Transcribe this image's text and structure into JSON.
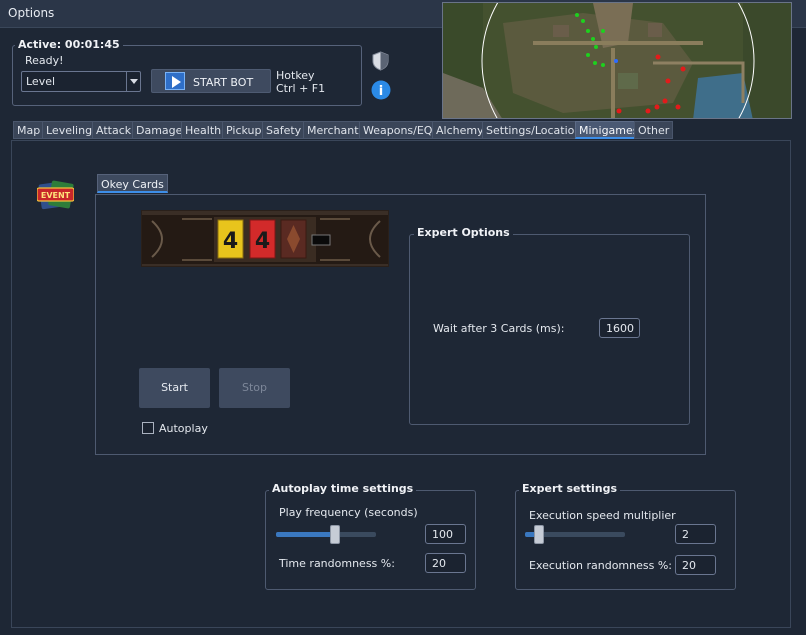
{
  "window": {
    "title": "Options"
  },
  "status": {
    "active_label": "Active: 00:01:45",
    "state": "Ready!",
    "mode": "Level",
    "start_button": "START BOT",
    "hotkey_label": "Hotkey",
    "hotkey_value": "Ctrl + F1",
    "info_icon_text": "i"
  },
  "tabs": [
    {
      "label": "Map"
    },
    {
      "label": "Leveling"
    },
    {
      "label": "Attack"
    },
    {
      "label": "Damage"
    },
    {
      "label": "Health"
    },
    {
      "label": "Pickup"
    },
    {
      "label": "Safety"
    },
    {
      "label": "Merchant"
    },
    {
      "label": "Weapons/EQ"
    },
    {
      "label": "Alchemy"
    },
    {
      "label": "Settings/Location"
    },
    {
      "label": "Minigames",
      "active": true
    },
    {
      "label": "Other"
    }
  ],
  "event_badge": {
    "text": "EVENT"
  },
  "minigame": {
    "tab_label": "Okey Cards",
    "cards": [
      "4",
      "4"
    ],
    "start_label": "Start",
    "stop_label": "Stop",
    "autoplay_label": "Autoplay",
    "autoplay_checked": false
  },
  "expert_options": {
    "title": "Expert Options",
    "wait_label": "Wait after 3 Cards (ms):",
    "wait_value": "1600"
  },
  "autoplay_time": {
    "title": "Autoplay time settings",
    "freq_label": "Play frequency (seconds)",
    "freq_slider_fraction": 0.59,
    "freq_value": "100",
    "random_label": "Time randomness %:",
    "random_value": "20"
  },
  "expert_settings": {
    "title": "Expert settings",
    "speed_label": "Execution speed multiplier",
    "speed_slider_fraction": 0.14,
    "speed_value": "2",
    "random_label": "Execution randomness %:",
    "random_value": "20"
  },
  "colors": {
    "background": "#1e2735",
    "accent": "#3d8ee8",
    "card_yellow": "#e8c41c",
    "card_red": "#d22a2a"
  }
}
